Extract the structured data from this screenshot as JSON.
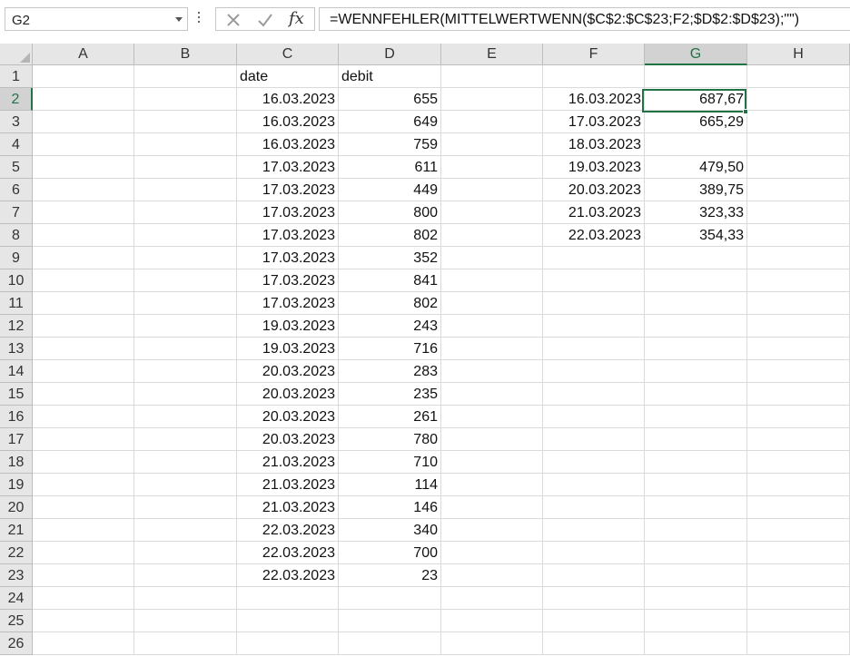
{
  "name_box": {
    "value": "G2"
  },
  "formula_bar": {
    "formula": "=WENNFEHLER(MITTELWERTWENN($C$2:$C$23;F2;$D$2:$D$23);\"\")"
  },
  "icons": {
    "cancel": "close-icon",
    "enter": "check-icon",
    "function": "fx-icon",
    "fx_glyph": "fx"
  },
  "colors": {
    "accent": "#217346",
    "header_bg": "#e6e6e6",
    "grid_line": "#dadada"
  },
  "sheet": {
    "active_cell": "G2",
    "columns": [
      "A",
      "B",
      "C",
      "D",
      "E",
      "F",
      "G",
      "H"
    ],
    "rows": [
      {
        "num": "1",
        "C": "date",
        "D": "debit",
        "F": "",
        "G": ""
      },
      {
        "num": "2",
        "C": "16.03.2023",
        "D": "655",
        "F": "16.03.2023",
        "G": "687,67"
      },
      {
        "num": "3",
        "C": "16.03.2023",
        "D": "649",
        "F": "17.03.2023",
        "G": "665,29"
      },
      {
        "num": "4",
        "C": "16.03.2023",
        "D": "759",
        "F": "18.03.2023",
        "G": ""
      },
      {
        "num": "5",
        "C": "17.03.2023",
        "D": "611",
        "F": "19.03.2023",
        "G": "479,50"
      },
      {
        "num": "6",
        "C": "17.03.2023",
        "D": "449",
        "F": "20.03.2023",
        "G": "389,75"
      },
      {
        "num": "7",
        "C": "17.03.2023",
        "D": "800",
        "F": "21.03.2023",
        "G": "323,33"
      },
      {
        "num": "8",
        "C": "17.03.2023",
        "D": "802",
        "F": "22.03.2023",
        "G": "354,33"
      },
      {
        "num": "9",
        "C": "17.03.2023",
        "D": "352",
        "F": "",
        "G": ""
      },
      {
        "num": "10",
        "C": "17.03.2023",
        "D": "841",
        "F": "",
        "G": ""
      },
      {
        "num": "11",
        "C": "17.03.2023",
        "D": "802",
        "F": "",
        "G": ""
      },
      {
        "num": "12",
        "C": "19.03.2023",
        "D": "243",
        "F": "",
        "G": ""
      },
      {
        "num": "13",
        "C": "19.03.2023",
        "D": "716",
        "F": "",
        "G": ""
      },
      {
        "num": "14",
        "C": "20.03.2023",
        "D": "283",
        "F": "",
        "G": ""
      },
      {
        "num": "15",
        "C": "20.03.2023",
        "D": "235",
        "F": "",
        "G": ""
      },
      {
        "num": "16",
        "C": "20.03.2023",
        "D": "261",
        "F": "",
        "G": ""
      },
      {
        "num": "17",
        "C": "20.03.2023",
        "D": "780",
        "F": "",
        "G": ""
      },
      {
        "num": "18",
        "C": "21.03.2023",
        "D": "710",
        "F": "",
        "G": ""
      },
      {
        "num": "19",
        "C": "21.03.2023",
        "D": "114",
        "F": "",
        "G": ""
      },
      {
        "num": "20",
        "C": "21.03.2023",
        "D": "146",
        "F": "",
        "G": ""
      },
      {
        "num": "21",
        "C": "22.03.2023",
        "D": "340",
        "F": "",
        "G": ""
      },
      {
        "num": "22",
        "C": "22.03.2023",
        "D": "700",
        "F": "",
        "G": ""
      },
      {
        "num": "23",
        "C": "22.03.2023",
        "D": "23",
        "F": "",
        "G": ""
      },
      {
        "num": "24",
        "C": "",
        "D": "",
        "F": "",
        "G": ""
      },
      {
        "num": "25",
        "C": "",
        "D": "",
        "F": "",
        "G": ""
      },
      {
        "num": "26",
        "C": "",
        "D": "",
        "F": "",
        "G": ""
      }
    ]
  }
}
